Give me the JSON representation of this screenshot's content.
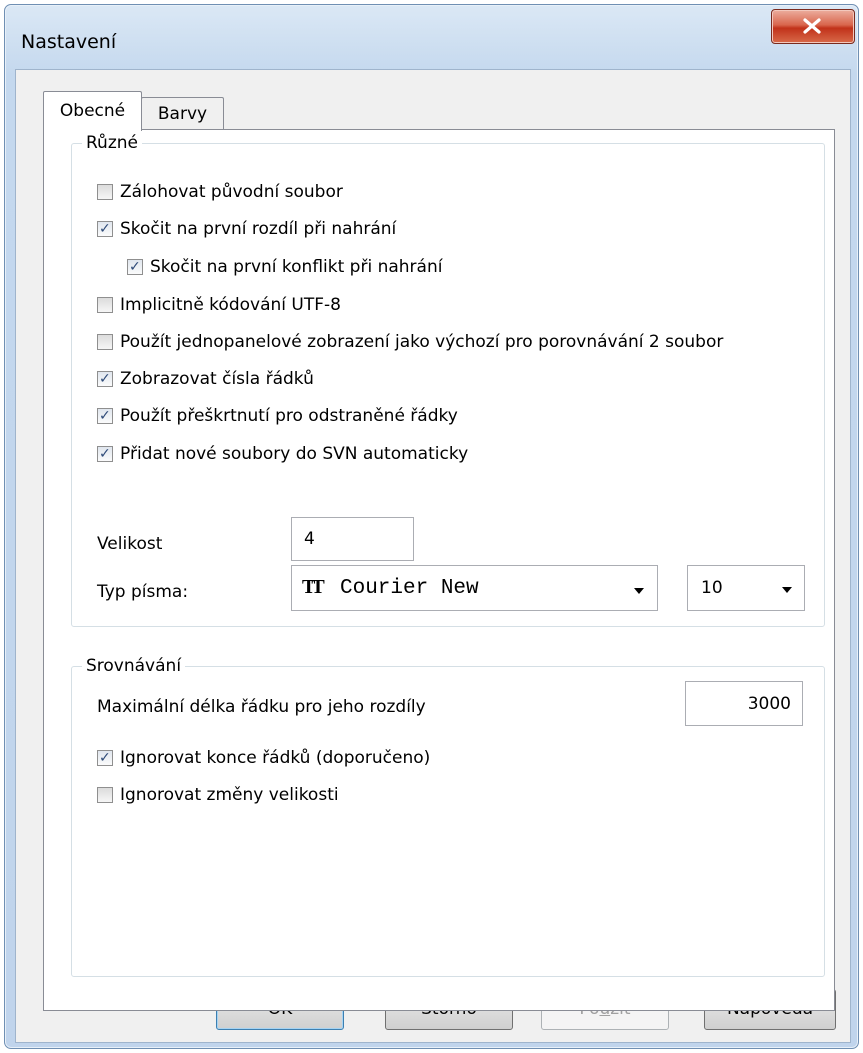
{
  "window": {
    "title": "Nastavení"
  },
  "tabs": [
    {
      "label": "Obecné",
      "active": true
    },
    {
      "label": "Barvy",
      "active": false
    }
  ],
  "group_misc": {
    "title": "Různé",
    "checkboxes": [
      {
        "label": "Zálohovat původní soubor",
        "checked": false
      },
      {
        "label": "Skočit na první rozdíl při nahrání",
        "checked": true
      },
      {
        "label": "Skočit na první konflikt při nahrání",
        "checked": true
      },
      {
        "label": "Implicitně kódování UTF-8",
        "checked": false
      },
      {
        "label": "Použít jednopanelové zobrazení jako výchozí pro porovnávání 2 soubor",
        "checked": false
      },
      {
        "label": "Zobrazovat čísla řádků",
        "checked": true
      },
      {
        "label": "Použít přeškrtnutí pro odstraněné řádky",
        "checked": true
      },
      {
        "label": "Přidat nové soubory do SVN automaticky",
        "checked": true
      }
    ],
    "size_label": "Velikost",
    "size_value": "4",
    "font_label": "Typ písma:",
    "font_value": "Courier New",
    "font_icon": "truetype-font-icon",
    "font_size_value": "10"
  },
  "group_compare": {
    "title": "Srovnávání",
    "max_line_label": "Maximální délka řádku pro jeho rozdíly",
    "max_line_value": "3000",
    "checkboxes": [
      {
        "label": "Ignorovat konce řádků (doporučeno)",
        "checked": true
      },
      {
        "label": "Ignorovat změny velikosti",
        "checked": false
      }
    ]
  },
  "buttons": {
    "ok": "OK",
    "cancel": "Storno",
    "apply_pre": "Po",
    "apply_mnemonic": "u",
    "apply_post": "žít",
    "help": "Nápověda"
  },
  "colors": {
    "check_mark": "#2e4a78",
    "close_button": "#c1321a",
    "title_bar": "#c4d8ee"
  }
}
